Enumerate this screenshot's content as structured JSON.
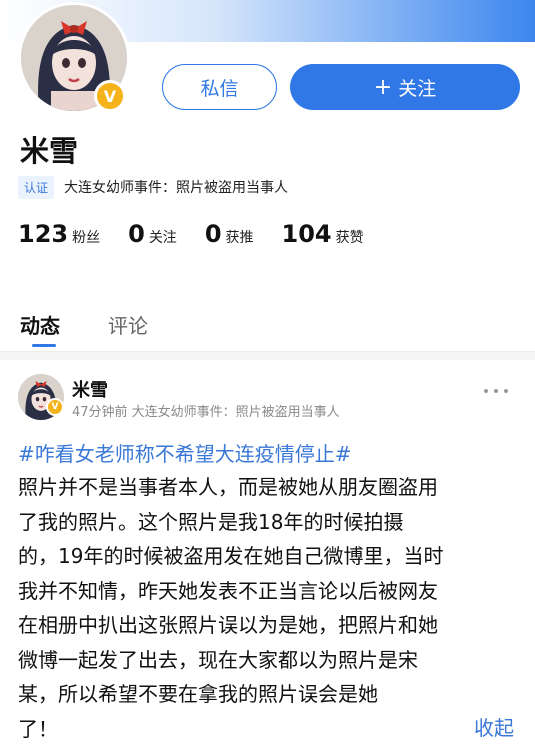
{
  "profile": {
    "name": "米雪",
    "verify_badge": "V",
    "cert_tag": "认证",
    "cert_text": "大连女幼师事件：照片被盗用当事人",
    "message_button": "私信",
    "follow_button_icon": "+",
    "follow_button": "关注",
    "stats": [
      {
        "num": "123",
        "label": "粉丝"
      },
      {
        "num": "0",
        "label": "关注"
      },
      {
        "num": "0",
        "label": "获推"
      },
      {
        "num": "104",
        "label": "获赞"
      }
    ]
  },
  "tabs": [
    {
      "label": "动态"
    },
    {
      "label": "评论"
    }
  ],
  "post": {
    "author": "米雪",
    "badge": "V",
    "meta": "47分钟前  大连女幼师事件：照片被盗用当事人",
    "hashtag": "#咋看女老师称不希望大连疫情停止#",
    "lines": [
      "照片并不是当事者本人，而是被她从朋友圈盗用",
      "了我的照片。这个照片是我18年的时候拍摄",
      "的，19年的时候被盗用发在她自己微博里，当时",
      "我并不知情，昨天她发表不正当言论以后被网友",
      "在相册中扒出这张照片误以为是她，把照片和她",
      "微博一起发了出去，现在大家都以为照片是宋",
      "某，所以希望不要在拿我的照片误会是她",
      "了！"
    ],
    "collapse_label": "收起"
  },
  "colors": {
    "accent": "#2f78e6",
    "link": "#3a78d8",
    "badge": "#f6b21b"
  }
}
